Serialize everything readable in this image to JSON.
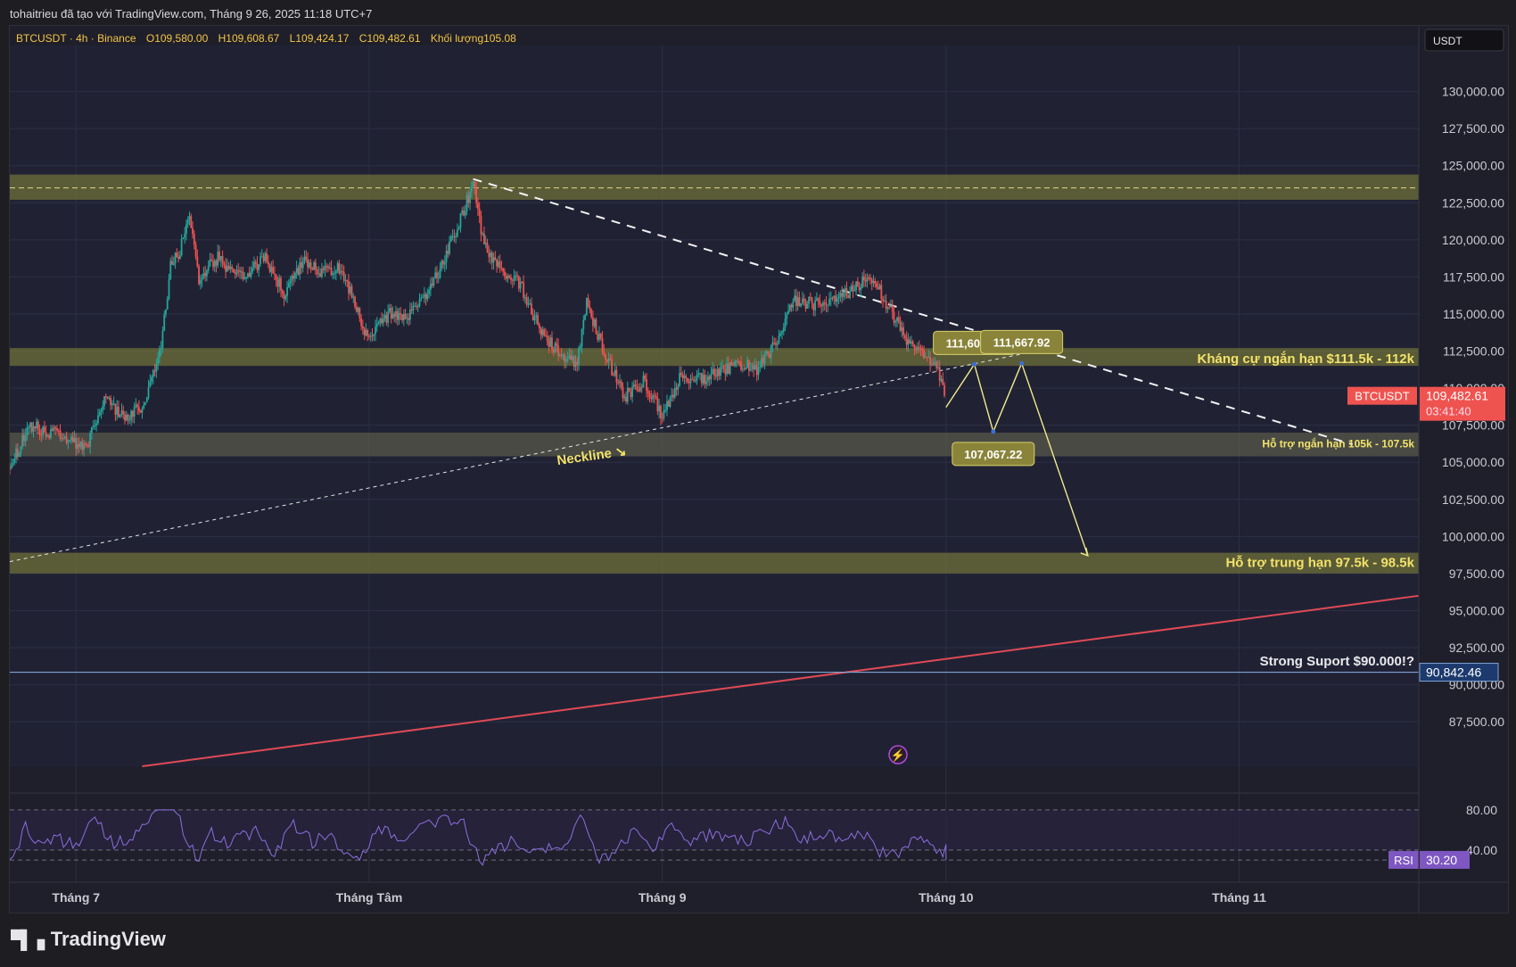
{
  "header": {
    "attribution": "tohaitrieu đã tạo với TradingView.com, Tháng 9 26, 2025 11:18 UTC+7"
  },
  "footer": {
    "brand": "TradingView",
    "logo_icon": "tradingview-logo-icon"
  },
  "chart_data": {
    "type": "candlestick",
    "symbol_line": {
      "symbol": "BTCUSDT · 4h · Binance",
      "o_label": "O",
      "open": "109,580.00",
      "h_label": "H",
      "high": "109,608.67",
      "l_label": "L",
      "low": "109,424.17",
      "c_label": "C",
      "close": "109,482.61",
      "vol_label": "Khối lượng",
      "volume": "105.08"
    },
    "currency": "USDT",
    "y_ticks": [
      "130,000.00",
      "127,500.00",
      "125,000.00",
      "122,500.00",
      "120,000.00",
      "117,500.00",
      "115,000.00",
      "112,500.00",
      "110,000.00",
      "107,500.00",
      "105,000.00",
      "102,500.00",
      "100,000.00",
      "97,500.00",
      "95,000.00",
      "92,500.00",
      "90,000.00",
      "87,500.00"
    ],
    "y_tick_values": [
      130000,
      127500,
      125000,
      122500,
      120000,
      117500,
      115000,
      112500,
      110000,
      107500,
      105000,
      102500,
      100000,
      97500,
      95000,
      92500,
      90000,
      87500
    ],
    "ylim": [
      84500,
      132500
    ],
    "x_ticks": [
      {
        "label": "Tháng 7",
        "day": 0
      },
      {
        "label": "Tháng Tâm",
        "day": 31
      },
      {
        "label": "Tháng 9",
        "day": 62
      },
      {
        "label": "Tháng 10",
        "day": 92
      },
      {
        "label": "Tháng 11",
        "day": 123
      }
    ],
    "xlim_days": [
      -7,
      142
    ],
    "price_series": [
      [
        -7,
        104600
      ],
      [
        -5,
        107500
      ],
      [
        -3,
        107100
      ],
      [
        -1,
        106700
      ],
      [
        1,
        105800
      ],
      [
        3,
        109200
      ],
      [
        5,
        108100
      ],
      [
        7,
        108600
      ],
      [
        9,
        112800
      ],
      [
        10,
        118200
      ],
      [
        11,
        119200
      ],
      [
        12,
        121800
      ],
      [
        13,
        117400
      ],
      [
        15,
        118800
      ],
      [
        16,
        117800
      ],
      [
        18,
        117600
      ],
      [
        20,
        118900
      ],
      [
        22,
        116400
      ],
      [
        24,
        118600
      ],
      [
        26,
        117800
      ],
      [
        28,
        118200
      ],
      [
        30,
        114700
      ],
      [
        31,
        113200
      ],
      [
        33,
        115000
      ],
      [
        35,
        114700
      ],
      [
        37,
        116100
      ],
      [
        39,
        118700
      ],
      [
        41,
        122000
      ],
      [
        42,
        123800
      ],
      [
        43,
        120000
      ],
      [
        45,
        117800
      ],
      [
        47,
        117000
      ],
      [
        49,
        114000
      ],
      [
        51,
        112300
      ],
      [
        53,
        111800
      ],
      [
        54,
        115800
      ],
      [
        56,
        112200
      ],
      [
        58,
        109400
      ],
      [
        60,
        110500
      ],
      [
        62,
        108200
      ],
      [
        64,
        110800
      ],
      [
        66,
        110600
      ],
      [
        68,
        111000
      ],
      [
        70,
        111600
      ],
      [
        72,
        111300
      ],
      [
        74,
        113000
      ],
      [
        76,
        116000
      ],
      [
        78,
        115600
      ],
      [
        80,
        116100
      ],
      [
        82,
        116600
      ],
      [
        84,
        117600
      ],
      [
        86,
        115400
      ],
      [
        88,
        112900
      ],
      [
        90,
        112300
      ],
      [
        91,
        111300
      ],
      [
        92,
        109480
      ]
    ],
    "price_line": {
      "label": "BTCUSDT",
      "value": "109,482.61",
      "countdown": "03:41:40",
      "price": 109482.61
    },
    "zones": [
      {
        "top": 124400,
        "bottom": 122700,
        "color": "#8a8a3a"
      },
      {
        "top": 112700,
        "bottom": 111500,
        "color": "#8a8a3a"
      },
      {
        "top": 107000,
        "bottom": 105400,
        "color": "#6b6b52"
      },
      {
        "top": 98900,
        "bottom": 97500,
        "color": "#8a8a3a"
      }
    ],
    "annotations": [
      {
        "text": "Kháng cự ngắn hạn $111.5k - 112k",
        "price": 112000,
        "color": "#f2e26a"
      },
      {
        "text": "Hỗ trợ ngắn hạn 105k - 107.5k",
        "price": 106300,
        "color": "#f2e26a"
      },
      {
        "text": "Hỗ trợ trung hạn 97.5k - 98.5k",
        "price": 98250,
        "color": "#f2e26a"
      },
      {
        "text": "Strong Suport $90.000!?",
        "price": 91600,
        "color": "#e8e8ec"
      }
    ],
    "neckline": {
      "label": "Neckline ↘"
    },
    "horizontal_line": {
      "price": 90842.46,
      "label": "90,842.46",
      "color": "#7fa4d6"
    },
    "projection": {
      "points": [
        [
          92,
          108700
        ],
        [
          95,
          111608.17
        ],
        [
          97,
          107067.22
        ],
        [
          100,
          111667.92
        ],
        [
          107,
          98700
        ]
      ],
      "labels": [
        {
          "text": "111,608.17",
          "day": 95,
          "price": 111608.17
        },
        {
          "text": "111,667.92",
          "day": 100,
          "price": 111667.92
        },
        {
          "text": "107,067.22",
          "day": 97,
          "price": 107067.22
        }
      ]
    },
    "rsi": {
      "label": "RSI",
      "value": "30.20",
      "levels": [
        "80.00",
        "40.00"
      ],
      "level_values": [
        80,
        40
      ],
      "ylim": [
        15,
        95
      ],
      "current": 30.2
    }
  },
  "colors": {
    "up": "#26a69a",
    "down": "#ef5350",
    "zone": "#8a8a3a",
    "rsi": "#7e57c2",
    "bg": "#22223a"
  }
}
